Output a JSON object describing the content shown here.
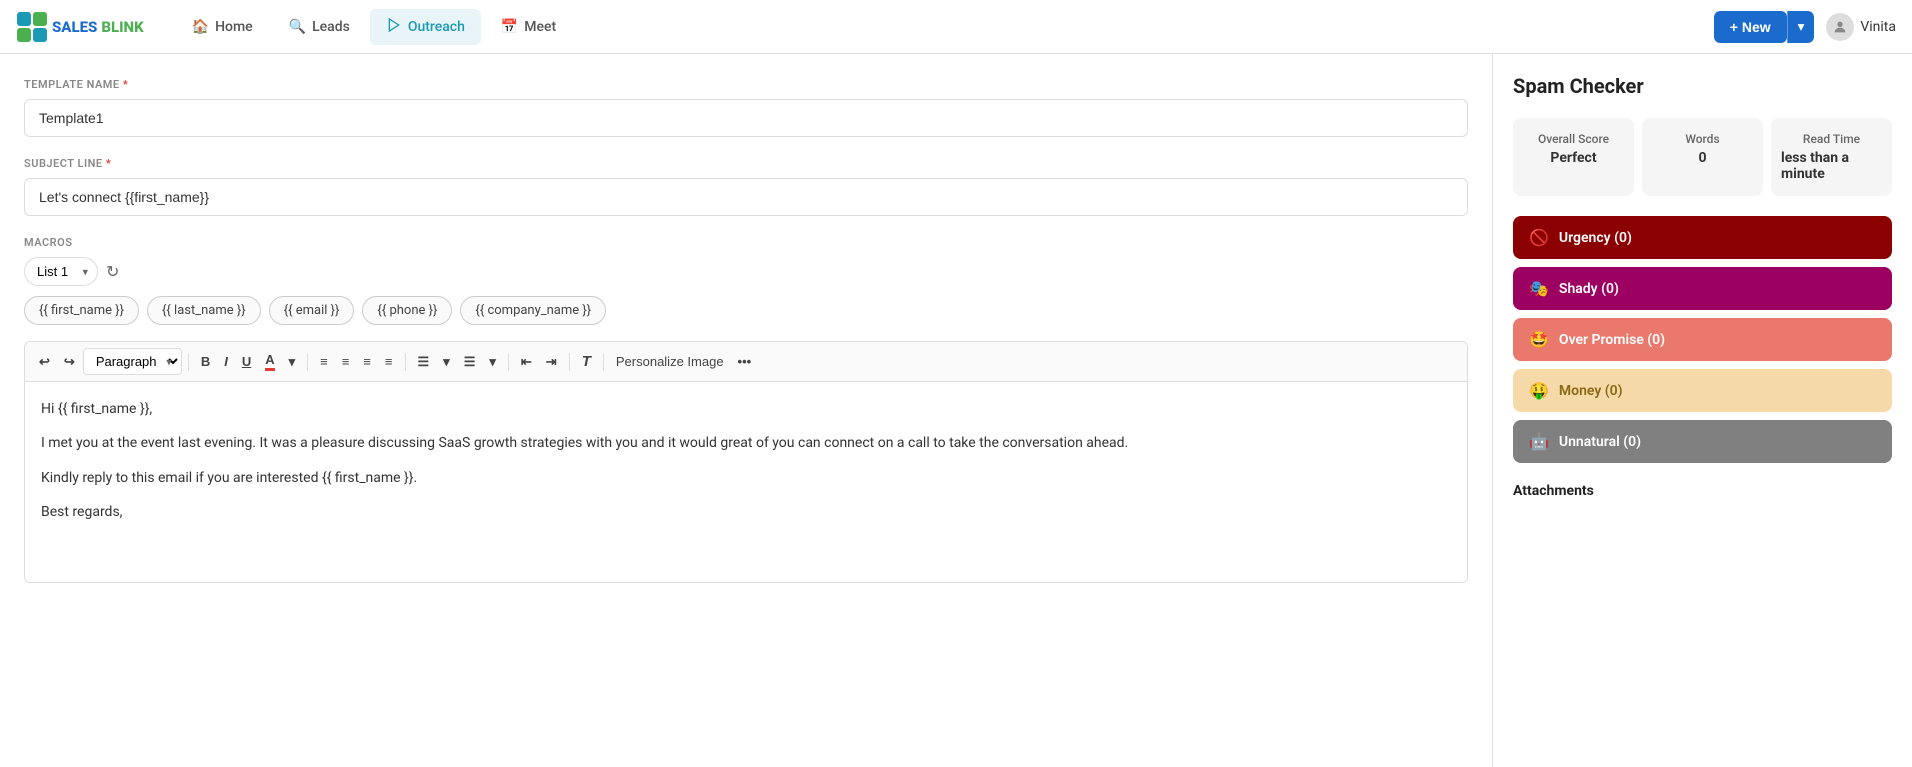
{
  "app": {
    "logo_text": "SALESBLINK",
    "logo_blue": "SALES",
    "logo_green": "BLINK"
  },
  "nav": {
    "items": [
      {
        "id": "home",
        "label": "Home",
        "icon": "home-icon",
        "active": false
      },
      {
        "id": "leads",
        "label": "Leads",
        "icon": "search-icon",
        "active": false
      },
      {
        "id": "outreach",
        "label": "Outreach",
        "icon": "outreach-icon",
        "active": true
      },
      {
        "id": "meet",
        "label": "Meet",
        "icon": "calendar-icon",
        "active": false
      }
    ],
    "new_button_label": "+ New",
    "user_name": "Vinita"
  },
  "form": {
    "template_name_label": "TEMPLATE NAME",
    "template_name_value": "Template1",
    "subject_line_label": "SUBJECT LINE",
    "subject_line_value": "Let's connect {{first_name}}",
    "macros_label": "MACROS",
    "macro_list_default": "List 1",
    "macro_tags": [
      "{{ first_name }}",
      "{{ last_name }}",
      "{{ email }}",
      "{{ phone }}",
      "{{ company_name }}"
    ],
    "toolbar": {
      "paragraph_label": "Paragraph",
      "bold": "B",
      "italic": "I",
      "underline": "U",
      "personalize_image": "Personalize Image",
      "more": "..."
    },
    "body_lines": [
      "Hi {{ first_name }},",
      "I met you at the event last evening. It was a pleasure discussing SaaS growth strategies with you and it would great of you can connect on a call to take the conversation ahead.",
      "Kindly reply to this email if you are interested {{ first_name }}.",
      "Best regards,"
    ]
  },
  "spam_checker": {
    "title": "Spam Checker",
    "overall_score_label": "Overall Score",
    "overall_score_value": "Perfect",
    "words_label": "Words",
    "words_value": "0",
    "read_time_label": "Read Time",
    "read_time_value": "less than a minute",
    "bars": [
      {
        "id": "urgency",
        "label": "Urgency (0)",
        "icon": "🚫",
        "class": "urgency"
      },
      {
        "id": "shady",
        "label": "Shady (0)",
        "icon": "🎭",
        "class": "shady"
      },
      {
        "id": "over-promise",
        "label": "Over Promise (0)",
        "icon": "🤩",
        "class": "over-promise"
      },
      {
        "id": "money",
        "label": "Money (0)",
        "icon": "🤑",
        "class": "money"
      },
      {
        "id": "unnatural",
        "label": "Unnatural (0)",
        "icon": "🤖",
        "class": "unnatural"
      }
    ],
    "attachments_label": "Attachments"
  }
}
